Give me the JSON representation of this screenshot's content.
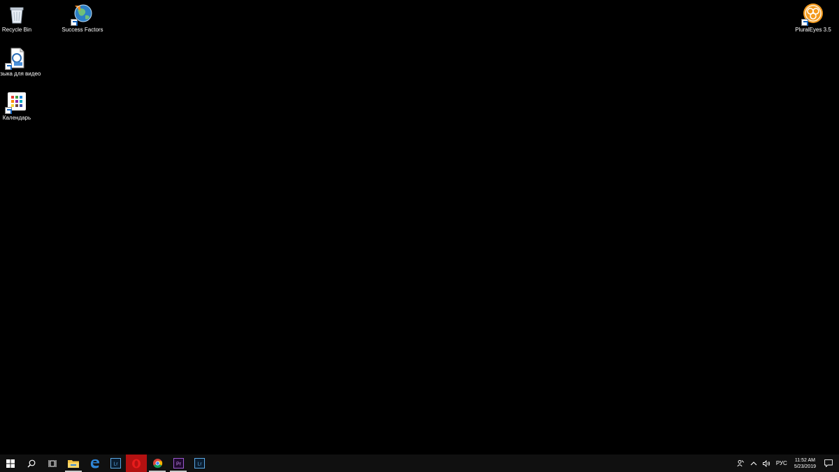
{
  "desktop": {
    "icons": [
      {
        "label": "Recycle Bin",
        "icon": "recycle-bin-icon"
      },
      {
        "label": "Success Factors",
        "icon": "globe-shortcut-icon"
      },
      {
        "label": "Музыка для видео",
        "icon": "music-file-icon"
      },
      {
        "label": "Календарь",
        "icon": "calendar-icon"
      },
      {
        "label": "PluralEyes 3.5",
        "icon": "pluraleyes-icon"
      }
    ]
  },
  "taskbar": {
    "apps": [
      {
        "name": "Start",
        "icon": "windows-logo-icon"
      },
      {
        "name": "Search",
        "icon": "search-icon"
      },
      {
        "name": "Task View",
        "icon": "task-view-icon"
      },
      {
        "name": "File Explorer",
        "icon": "folder-icon"
      },
      {
        "name": "Microsoft Edge",
        "icon": "edge-icon"
      },
      {
        "name": "Lightroom",
        "icon": "lightroom-icon",
        "text": "Lr"
      },
      {
        "name": "Opera",
        "icon": "opera-icon"
      },
      {
        "name": "Chrome",
        "icon": "chrome-icon"
      },
      {
        "name": "Premiere Pro",
        "icon": "premiere-icon",
        "text": "Pr"
      },
      {
        "name": "Lightroom",
        "icon": "lightroom-icon",
        "text": "Lr"
      }
    ],
    "tray": {
      "language": "РУС",
      "time": "11:52 AM",
      "date": "5/23/2019"
    }
  },
  "colors": {
    "desktop_bg": "#000000",
    "taskbar_bg": "#101010",
    "opera_active": "#b31111",
    "premiere_purple": "#9b59d0",
    "lightroom_blue": "#5aa9e6"
  }
}
